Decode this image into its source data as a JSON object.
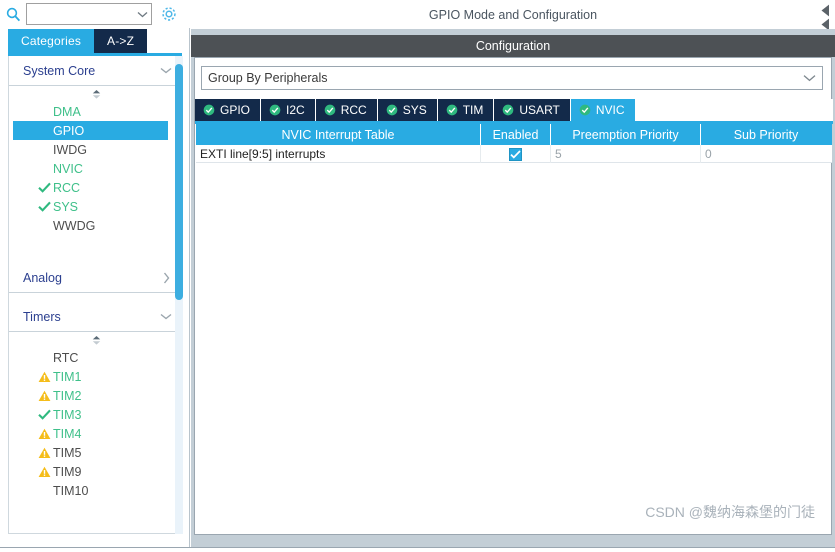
{
  "colors": {
    "accent_blue": "#29abe2",
    "tab_navy": "#132a4a",
    "config_bar_gray": "#4d5155",
    "panel_gray": "#c3ced6",
    "green_ok": "#3fc08a",
    "warn_yellow": "#f5bd1a",
    "section_title_blue": "#2b3f8f"
  },
  "sidebar": {
    "search": {
      "value": "",
      "placeholder": "",
      "icon": "search-icon",
      "chevron_icon": "chevron-down-icon"
    },
    "gear_icon": "gear-icon",
    "tabs": [
      {
        "label": "Categories",
        "active": true
      },
      {
        "label": "A->Z",
        "active": false
      }
    ],
    "sections": [
      {
        "title": "System Core",
        "expanded": true,
        "chevron_icon": "chevron-down-icon",
        "items": [
          {
            "label": "DMA",
            "status": "green",
            "mark": "none"
          },
          {
            "label": "GPIO",
            "status": "selected",
            "mark": "none"
          },
          {
            "label": "IWDG",
            "status": "dark",
            "mark": "none"
          },
          {
            "label": "NVIC",
            "status": "green",
            "mark": "none"
          },
          {
            "label": "RCC",
            "status": "green",
            "mark": "check"
          },
          {
            "label": "SYS",
            "status": "green",
            "mark": "check"
          },
          {
            "label": "WWDG",
            "status": "dark",
            "mark": "none"
          }
        ]
      },
      {
        "title": "Analog",
        "expanded": false,
        "chevron_icon": "chevron-right-icon",
        "items": []
      },
      {
        "title": "Timers",
        "expanded": true,
        "chevron_icon": "chevron-down-icon",
        "items": [
          {
            "label": "RTC",
            "status": "dark",
            "mark": "none"
          },
          {
            "label": "TIM1",
            "status": "green",
            "mark": "warning"
          },
          {
            "label": "TIM2",
            "status": "green",
            "mark": "warning"
          },
          {
            "label": "TIM3",
            "status": "green",
            "mark": "check"
          },
          {
            "label": "TIM4",
            "status": "green",
            "mark": "warning"
          },
          {
            "label": "TIM5",
            "status": "dark",
            "mark": "warning"
          },
          {
            "label": "TIM9",
            "status": "dark",
            "mark": "warning"
          },
          {
            "label": "TIM10",
            "status": "dark",
            "mark": "none"
          }
        ]
      }
    ]
  },
  "main": {
    "title": "GPIO Mode and Configuration",
    "collapse_icon": "double-chevron-left-icon",
    "config_header": "Configuration",
    "group_select": {
      "value": "Group By Peripherals",
      "chevron_icon": "chevron-down-icon"
    },
    "peripheral_tabs": [
      {
        "label": "GPIO",
        "active": false,
        "icon": "check-circle-icon"
      },
      {
        "label": "I2C",
        "active": false,
        "icon": "check-circle-icon"
      },
      {
        "label": "RCC",
        "active": false,
        "icon": "check-circle-icon"
      },
      {
        "label": "SYS",
        "active": false,
        "icon": "check-circle-icon"
      },
      {
        "label": "TIM",
        "active": false,
        "icon": "check-circle-icon"
      },
      {
        "label": "USART",
        "active": false,
        "icon": "check-circle-icon"
      },
      {
        "label": "NVIC",
        "active": true,
        "icon": "check-circle-icon"
      }
    ],
    "nvic_table": {
      "columns": [
        "NVIC Interrupt Table",
        "Enabled",
        "Preemption Priority",
        "Sub Priority"
      ],
      "rows": [
        {
          "name": "EXTI line[9:5] interrupts",
          "enabled": true,
          "preemption_priority": "5",
          "sub_priority": "0"
        }
      ]
    }
  },
  "watermark": "CSDN @魏纳海森堡的门徒"
}
